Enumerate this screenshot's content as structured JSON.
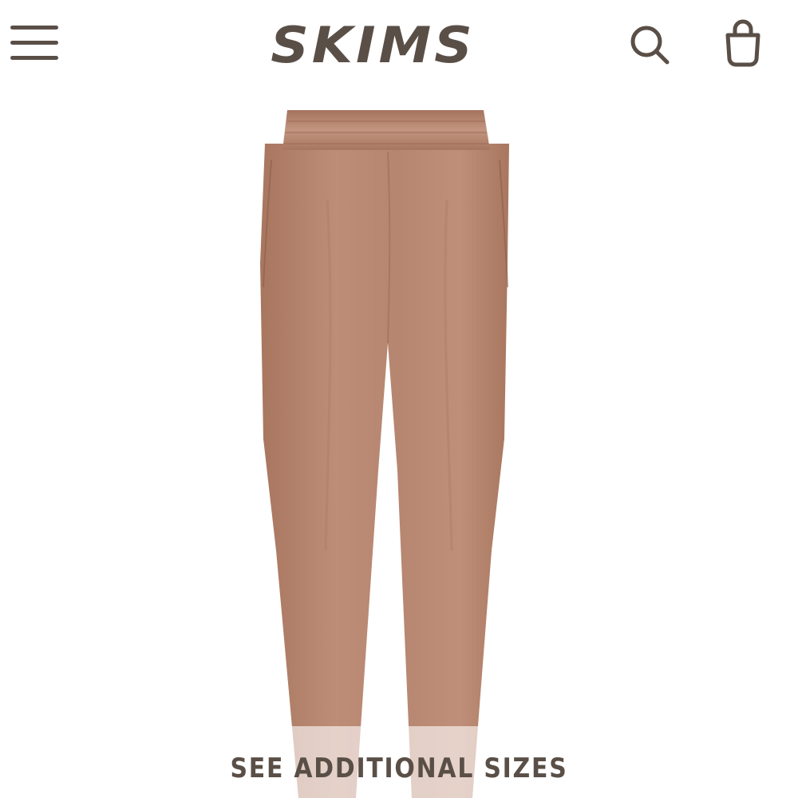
{
  "header": {
    "logo_text": "SKIMS",
    "menu_icon": "hamburger-menu-icon",
    "search_icon": "search-icon",
    "bag_icon": "shopping-bag-icon"
  },
  "product": {
    "image_subject": "velour-jogger-pants",
    "image_color": "#b98872"
  },
  "main": {
    "see_sizes_label": "SEE ADDITIONAL SIZES"
  },
  "colors": {
    "brand": "#5a4f47",
    "background": "#ffffff"
  }
}
